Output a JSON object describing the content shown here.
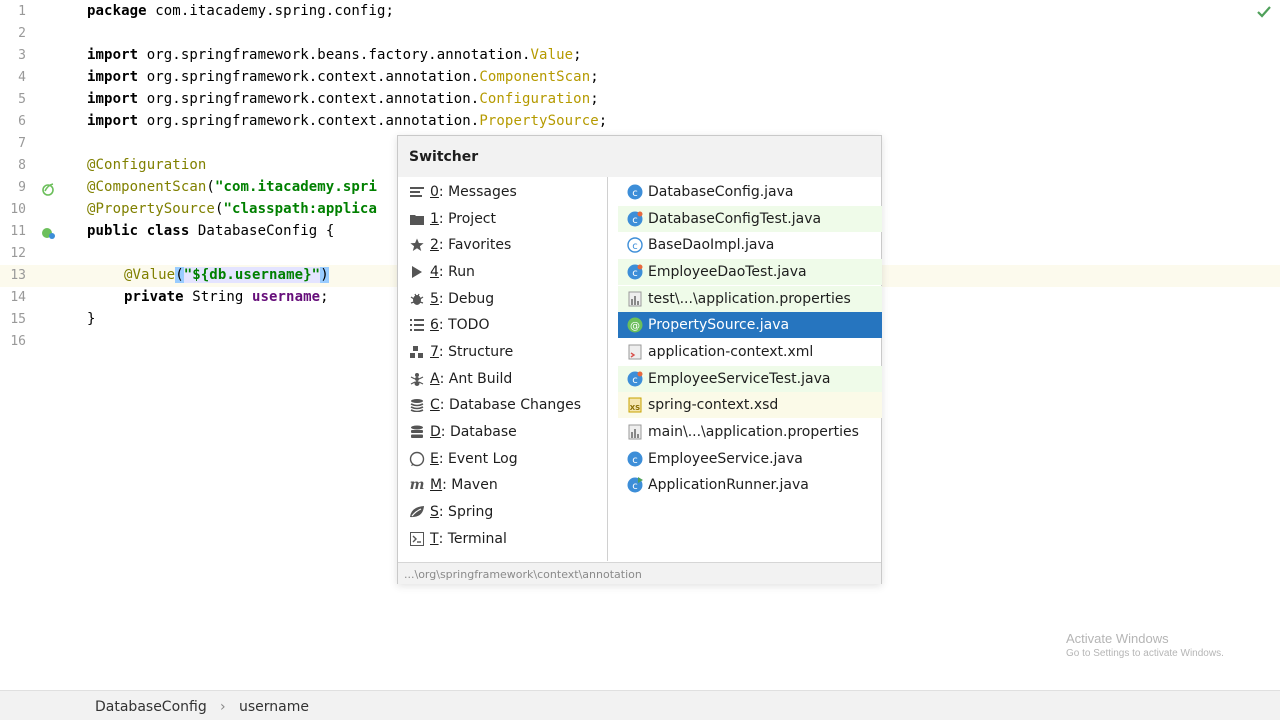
{
  "editor": {
    "lines": [
      {
        "n": "1"
      },
      {
        "n": "2"
      },
      {
        "n": "3"
      },
      {
        "n": "4"
      },
      {
        "n": "5"
      },
      {
        "n": "6"
      },
      {
        "n": "7"
      },
      {
        "n": "8"
      },
      {
        "n": "9"
      },
      {
        "n": "10"
      },
      {
        "n": "11"
      },
      {
        "n": "12"
      },
      {
        "n": "13"
      },
      {
        "n": "14"
      },
      {
        "n": "15"
      },
      {
        "n": "16"
      }
    ],
    "code": {
      "l1_kw": "package",
      "l1_rest": " com.itacademy.spring.config;",
      "l3_kw": "import",
      "l3_pkg": " org.springframework.beans.factory.annotation.",
      "l3_cls": "Value",
      "l3_end": ";",
      "l4_kw": "import",
      "l4_pkg": " org.springframework.context.annotation.",
      "l4_cls": "ComponentScan",
      "l4_end": ";",
      "l5_kw": "import",
      "l5_pkg": " org.springframework.context.annotation.",
      "l5_cls": "Configuration",
      "l5_end": ";",
      "l6_kw": "import",
      "l6_pkg": " org.springframework.context.annotation.",
      "l6_cls": "PropertySource",
      "l6_end": ";",
      "l8_anno": "@Configuration",
      "l9_anno": "@ComponentScan",
      "l9_open": "(",
      "l9_str": "\"com.itacademy.spri",
      "l10_anno": "@PropertySource",
      "l10_open": "(",
      "l10_str": "\"classpath:applica",
      "l11_kw": "public class",
      "l11_rest": " DatabaseConfig {",
      "l13_anno": "@Value",
      "l13_open": "(",
      "l13_str": "\"${db.username}\"",
      "l13_close": ")",
      "l14_kw": "private",
      "l14_type": " String ",
      "l14_field": "username",
      "l14_end": ";",
      "l15": "}"
    }
  },
  "switcher": {
    "title": "Switcher",
    "tools": [
      {
        "key": "0",
        "label": ": Messages",
        "icon": "messages-icon"
      },
      {
        "key": "1",
        "label": ": Project",
        "icon": "folder-icon"
      },
      {
        "key": "2",
        "label": ": Favorites",
        "icon": "star-icon"
      },
      {
        "key": "4",
        "label": ": Run",
        "icon": "run-icon"
      },
      {
        "key": "5",
        "label": ": Debug",
        "icon": "bug-icon"
      },
      {
        "key": "6",
        "label": ": TODO",
        "icon": "todo-icon"
      },
      {
        "key": "7",
        "label": ": Structure",
        "icon": "structure-icon"
      },
      {
        "key": "A",
        "label": ": Ant Build",
        "icon": "ant-icon"
      },
      {
        "key": "C",
        "label": ": Database Changes",
        "icon": "database-changes-icon"
      },
      {
        "key": "D",
        "label": ": Database",
        "icon": "database-icon"
      },
      {
        "key": "E",
        "label": ": Event Log",
        "icon": "event-log-icon"
      },
      {
        "key": "M",
        "label": ": Maven",
        "icon": "maven-icon"
      },
      {
        "key": "S",
        "label": ": Spring",
        "icon": "spring-icon"
      },
      {
        "key": "T",
        "label": ": Terminal",
        "icon": "terminal-icon"
      }
    ],
    "files": [
      {
        "name": "DatabaseConfig.java",
        "icon": "java-class-icon",
        "state": "normal"
      },
      {
        "name": "DatabaseConfigTest.java",
        "icon": "java-test-class-icon",
        "state": "green"
      },
      {
        "name": "BaseDaoImpl.java",
        "icon": "java-class-icon",
        "state": "normal"
      },
      {
        "name": "EmployeeDaoTest.java",
        "icon": "java-test-class-icon",
        "state": "green"
      },
      {
        "name": "test\\...\\application.properties",
        "icon": "properties-file-icon",
        "state": "green"
      },
      {
        "name": "PropertySource.java",
        "icon": "annotation-class-icon",
        "state": "selected"
      },
      {
        "name": "application-context.xml",
        "icon": "xml-file-icon",
        "state": "normal"
      },
      {
        "name": "EmployeeServiceTest.java",
        "icon": "java-test-class-icon",
        "state": "green"
      },
      {
        "name": "spring-context.xsd",
        "icon": "xsd-file-icon",
        "state": "yellow"
      },
      {
        "name": "main\\...\\application.properties",
        "icon": "properties-file-icon",
        "state": "normal"
      },
      {
        "name": "EmployeeService.java",
        "icon": "java-class-icon",
        "state": "normal"
      },
      {
        "name": "ApplicationRunner.java",
        "icon": "java-runnable-class-icon",
        "state": "normal"
      }
    ],
    "status_path": "...\\org\\springframework\\context\\annotation"
  },
  "watermark": {
    "title": "Activate Windows",
    "subtitle": "Go to Settings to activate Windows."
  },
  "breadcrumb": {
    "items": [
      "DatabaseConfig",
      "username"
    ],
    "separator": "›"
  },
  "colors": {
    "selection": "#2675bf",
    "test_file_bg": "#effbe9",
    "library_file_bg": "#fbfae8",
    "annotation": "#808000",
    "string": "#008000",
    "field": "#660e7a"
  }
}
